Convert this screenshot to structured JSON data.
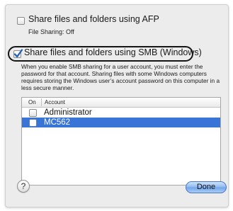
{
  "afp": {
    "checkbox_label": "Share files and folders using AFP",
    "checked": false,
    "status": "File Sharing: Off"
  },
  "smb": {
    "checkbox_label": "Share files and folders using SMB (Windows)",
    "checked": true,
    "description": "When you enable SMB sharing for a user account, you must enter the password for that account. Sharing files with some Windows computers requires storing the Windows user’s account password on this computer in a less secure manner."
  },
  "accounts_table": {
    "columns": [
      "On",
      "Account"
    ],
    "rows": [
      {
        "on": false,
        "account": "Administrator",
        "selected": false
      },
      {
        "on": false,
        "account": "MC562",
        "selected": true
      }
    ]
  },
  "buttons": {
    "help_label": "?",
    "done_label": "Done"
  },
  "colors": {
    "selection": "#3875d7",
    "checkmark": "#1f5fb4",
    "sheet_background": "#ececec"
  }
}
